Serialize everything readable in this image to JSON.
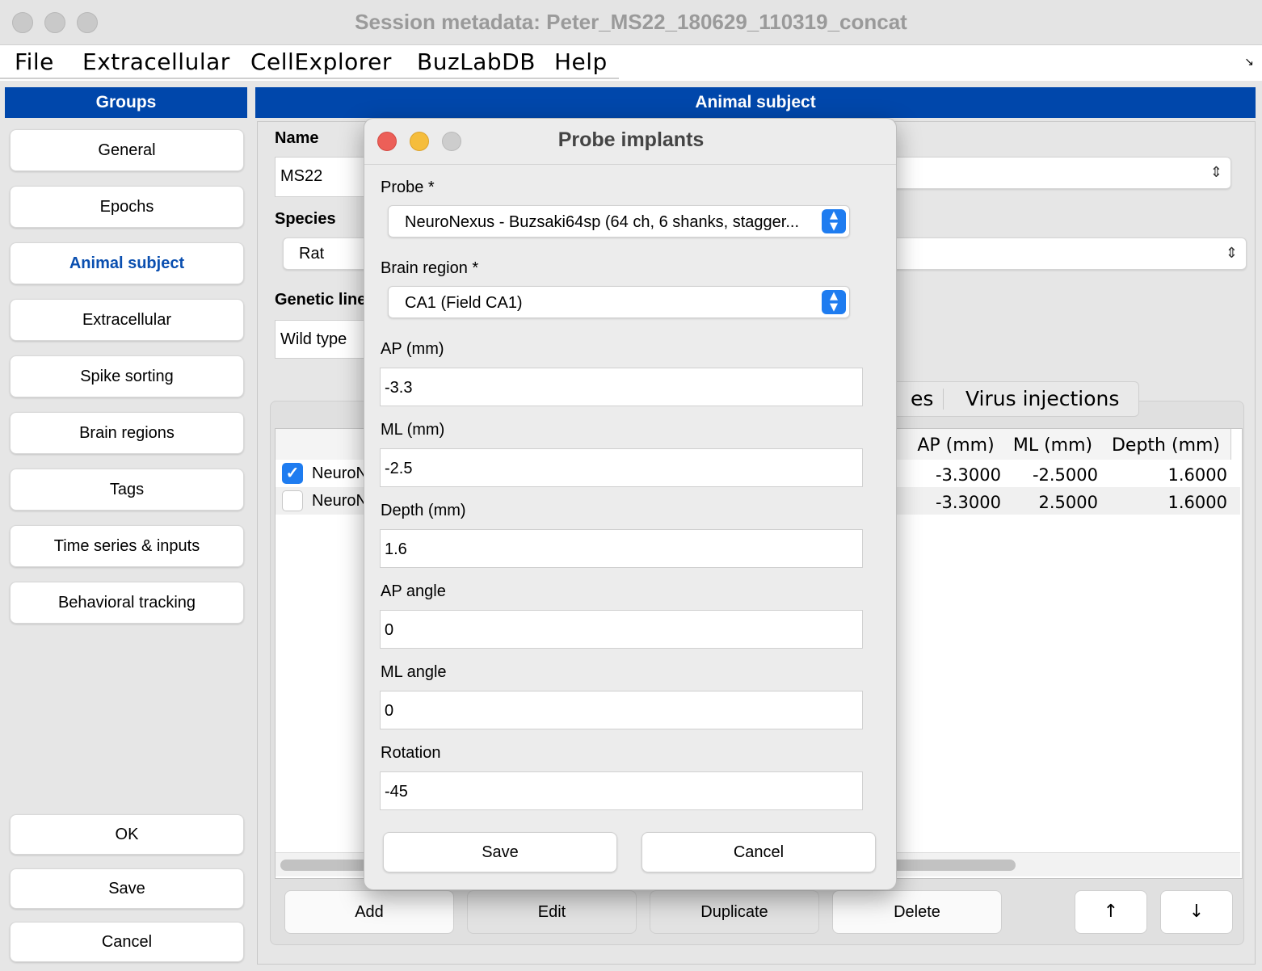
{
  "window": {
    "title": "Session metadata: Peter_MS22_180629_110319_concat"
  },
  "menu": [
    "File",
    "Extracellular",
    "CellExplorer",
    "BuzLabDB",
    "Help"
  ],
  "sidebar": {
    "header": "Groups",
    "items": [
      "General",
      "Epochs",
      "Animal subject",
      "Extracellular",
      "Spike sorting",
      "Brain regions",
      "Tags",
      "Time series & inputs",
      "Behavioral tracking"
    ],
    "active": "Animal subject",
    "actions": [
      "OK",
      "Save",
      "Cancel"
    ]
  },
  "main": {
    "header": "Animal subject",
    "name_label": "Name",
    "name_value": "MS22",
    "species_label": "Species",
    "species_value": "Rat",
    "genetic_label": "Genetic line",
    "genetic_value": "Wild type",
    "tabs": [
      "Surgeries",
      "Virus injections"
    ],
    "table": {
      "columns": [
        "AP (mm)",
        "ML (mm)",
        "Depth (mm)"
      ],
      "rows": [
        {
          "checked": true,
          "probe": "NeuroNexus",
          "ap": "-3.3000",
          "ml": "-2.5000",
          "depth": "1.6000"
        },
        {
          "checked": false,
          "probe": "NeuroNexus",
          "ap": "-3.3000",
          "ml": "2.5000",
          "depth": "1.6000"
        }
      ]
    },
    "buttons": [
      "Add",
      "Edit",
      "Duplicate",
      "Delete",
      "↑",
      "↓"
    ]
  },
  "dialog": {
    "title": "Probe implants",
    "probe_label": "Probe *",
    "probe_value": "NeuroNexus - Buzsaki64sp (64 ch, 6 shanks, stagger...",
    "region_label": "Brain region *",
    "region_value": "CA1 (Field CA1)",
    "fields": [
      {
        "label": "AP (mm)",
        "value": "-3.3"
      },
      {
        "label": "ML (mm)",
        "value": "-2.5"
      },
      {
        "label": "Depth (mm)",
        "value": "1.6"
      },
      {
        "label": "AP angle",
        "value": "0"
      },
      {
        "label": "ML angle",
        "value": "0"
      },
      {
        "label": "Rotation",
        "value": "-45"
      }
    ],
    "save_label": "Save",
    "cancel_label": "Cancel"
  },
  "colors": {
    "accent": "#0047ab",
    "checkbox": "#1e7cf0"
  }
}
